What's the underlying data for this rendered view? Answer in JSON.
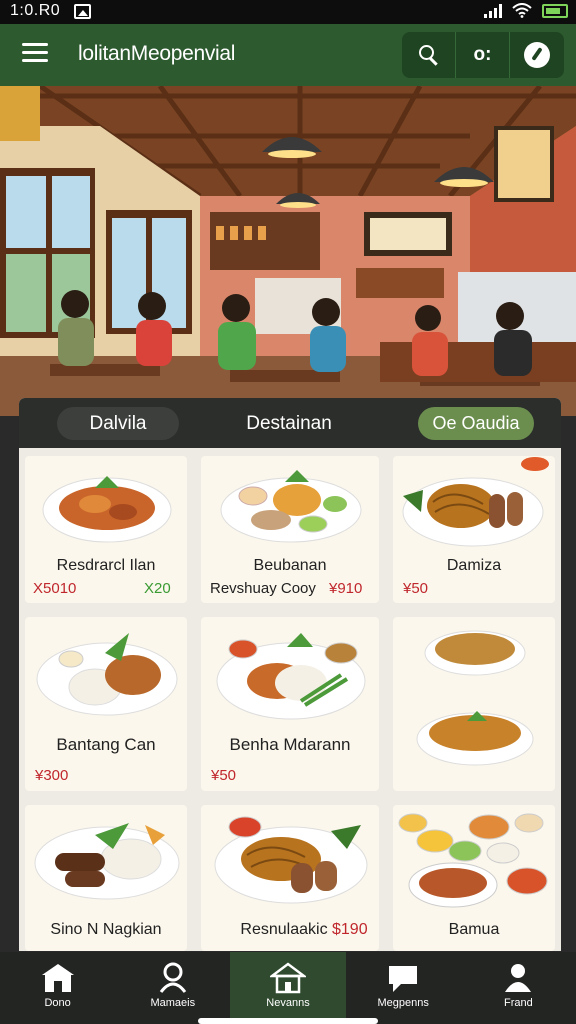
{
  "status_bar": {
    "time": "1:0.R0"
  },
  "app_bar": {
    "title": "lolitanMeopenvial",
    "action_text": "o:"
  },
  "tabs": [
    {
      "label": "Dalvila"
    },
    {
      "label": "Destainan"
    },
    {
      "label": "Oe Oaudia"
    }
  ],
  "dishes": [
    {
      "name": "Resdrarcl Ilan",
      "price": "X5010",
      "price2": "X20"
    },
    {
      "name": "Beubanan",
      "subtitle": "Revshuay  Cooy",
      "price": "¥910"
    },
    {
      "name": "Damiza",
      "price": "¥50"
    },
    {
      "name": "Bantang Can",
      "price": "¥300"
    },
    {
      "name": "Benha Mdarann",
      "price": "¥50"
    },
    {
      "name": "",
      "price": ""
    },
    {
      "name": "Sino N Nagkian"
    },
    {
      "name": "Resnulaakic",
      "price": "$190"
    },
    {
      "name": "Bamua"
    }
  ],
  "bottom_nav": [
    {
      "label": "Dono",
      "icon": "store-icon"
    },
    {
      "label": "Mamaeis",
      "icon": "person-search-icon"
    },
    {
      "label": "Nevanns",
      "icon": "home-icon",
      "active": true
    },
    {
      "label": "Megpenns",
      "icon": "chat-icon"
    },
    {
      "label": "Frand",
      "icon": "profile-icon"
    }
  ],
  "colors": {
    "app_bar": "#2d5a2f",
    "accent": "#6b8e4e",
    "price_red": "#c0272d",
    "price_green": "#3b9b33"
  }
}
